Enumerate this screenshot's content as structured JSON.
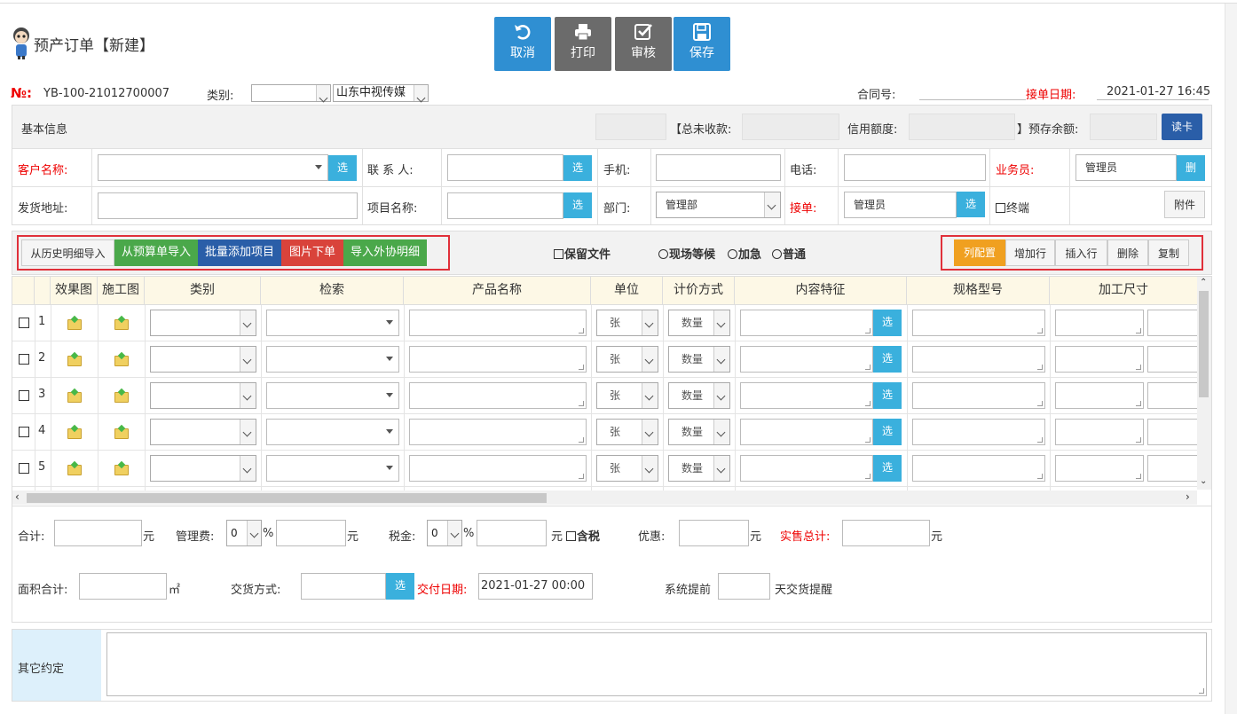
{
  "header": {
    "title": "预产订单【新建】"
  },
  "toolbar": {
    "cancel": "取消",
    "print": "打印",
    "audit": "审核",
    "save": "保存"
  },
  "order": {
    "no_label": "№:",
    "no_value": "YB-100-21012700007",
    "category_label": "类别:",
    "category_value": "",
    "company_value": "山东中视传媒",
    "contract_label": "合同号:",
    "contract_value": "",
    "date_label": "接单日期:",
    "date_value": "2021-01-27 16:45"
  },
  "basic": {
    "title": "基本信息",
    "unpaid_label": "【总未收款:",
    "credit_label": "信用额度:",
    "balance_label": "】预存余额:",
    "readcard": "读卡",
    "customer_label": "客户名称:",
    "contact_label": "联 系 人:",
    "mobile_label": "手机:",
    "phone_label": "电话:",
    "salesman_label": "业务员:",
    "salesman_value": "管理员",
    "del": "删",
    "address_label": "发货地址:",
    "project_label": "项目名称:",
    "dept_label": "部门:",
    "dept_value": "管理部",
    "receiver_label": "接单:",
    "receiver_value": "管理员",
    "terminal_label": "终端",
    "attach": "附件",
    "pick": "选"
  },
  "actions": {
    "history": "从历史明细导入",
    "budget": "从预算单导入",
    "batch": "批量添加项目",
    "image": "图片下单",
    "outsource": "导入外协明细",
    "keep_file": "保留文件",
    "wait": "现场等候",
    "urgent": "加急",
    "normal": "普通",
    "colcfg": "列配置",
    "addrow": "增加行",
    "insrow": "插入行",
    "delrow": "删除",
    "copy": "复制"
  },
  "table": {
    "headers": [
      "效果图",
      "施工图",
      "类别",
      "检索",
      "产品名称",
      "单位",
      "计价方式",
      "内容特征",
      "规格型号",
      "加工尺寸"
    ],
    "rows": [
      {
        "n": "1",
        "unit": "张",
        "price": "数量"
      },
      {
        "n": "2",
        "unit": "张",
        "price": "数量"
      },
      {
        "n": "3",
        "unit": "张",
        "price": "数量"
      },
      {
        "n": "4",
        "unit": "张",
        "price": "数量"
      },
      {
        "n": "5",
        "unit": "张",
        "price": "数量"
      }
    ]
  },
  "totals": {
    "sum_label": "合计:",
    "yuan": "元",
    "mgmt_label": "管理费:",
    "mgmt_value": "0",
    "pct": "%",
    "tax_label": "税金:",
    "tax_value": "0",
    "tax_incl": "含税",
    "discount_label": "优惠:",
    "actual_label": "实售总计:",
    "area_label": "面积合计:",
    "sqm": "㎡",
    "delivery_label": "交货方式:",
    "deliver_date_label": "交付日期:",
    "deliver_date_value": "2021-01-27 00:00",
    "remind_prefix": "系统提前",
    "remind_suffix": "天交货提醒"
  },
  "other": {
    "label": "其它约定"
  },
  "colors": {
    "blue": "#2f8fd2",
    "gray": "#6b6b6b",
    "green": "#4aa84a",
    "navy": "#2a5ea8",
    "red": "#d9433b",
    "orange": "#f0a020"
  }
}
